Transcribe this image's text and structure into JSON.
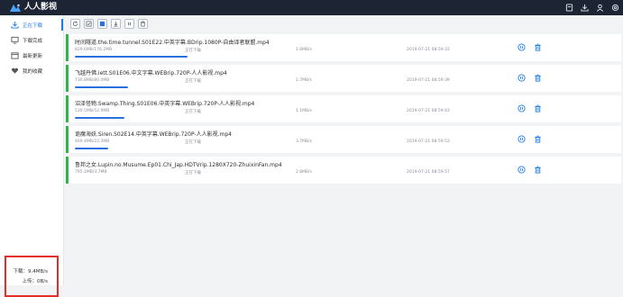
{
  "app": {
    "title": "人人影视",
    "accent": "#1e7ce8",
    "titlebar_bg": "#1d2535",
    "card_border": "#30b34a",
    "progress_color": "#2a6fe0"
  },
  "titlebar": {
    "icons": [
      {
        "name": "window-icon"
      },
      {
        "name": "download-icon"
      },
      {
        "name": "user-icon"
      },
      {
        "name": "settings-icon"
      }
    ]
  },
  "sidebar": {
    "items": [
      {
        "label": "正在下载",
        "icon": "download-icon"
      },
      {
        "label": "下载完成",
        "icon": "monitor-icon"
      },
      {
        "label": "最新更新",
        "icon": "calendar-icon"
      },
      {
        "label": "我的收藏",
        "icon": "heart-icon"
      }
    ],
    "speed": {
      "download": "下载：9.4MB/s",
      "upload": "上传：0B/s"
    }
  },
  "toolbar": {
    "buttons": [
      {
        "name": "refresh-button",
        "icon": "refresh-icon"
      },
      {
        "name": "select-all-button",
        "icon": "checkbox-icon"
      },
      {
        "name": "select-button",
        "icon": "checkbox-filled-icon"
      },
      {
        "name": "start-button",
        "icon": "arrow-down-icon"
      },
      {
        "name": "pause-button",
        "icon": "pause-icon"
      },
      {
        "name": "delete-button",
        "icon": "trash-icon"
      }
    ]
  },
  "downloads": [
    {
      "title": "时间隧道.the.time.tunnel.S01E22.中英字幕.BDrip.1080P-自由译者联盟.mp4",
      "size": "829.6MB/176.2MB",
      "status": "正在下载",
      "speed": "1.6MB/s",
      "time": "2019-07-21 08:59:33",
      "progress": 0.57
    },
    {
      "title": "飞越丹佛.iett.S01E06.中文字幕.WEBrip.720P-人人影视.mp4",
      "size": "730.8MB/80.0MB",
      "status": "正在下载",
      "speed": "2.7MB/s",
      "time": "2019-07-21 08:59:39",
      "progress": 0.27
    },
    {
      "title": "沼泽怪物.Swamp.Thing.S01E06.中英字幕.WEBrip.720P-人人影视.mp4",
      "size": "530.5MB/52.9MB",
      "status": "正在下载",
      "speed": "1.1MB/s",
      "time": "2019-07-21 08:59:43",
      "progress": 0.25
    },
    {
      "title": "诡魔海妖.Siren.S02E14.中英字幕.WEBrip.720P-人人影视.mp4",
      "size": "469.4MB/22.3MB",
      "status": "正在下载",
      "speed": "3.7MB/s",
      "time": "2019-07-21 08:59:53",
      "progress": 0.17
    },
    {
      "title": "鲁邦之女.Lupin.no.Musume.Ep01.Chi_Jap.HDTVrip.1280X720-ZhuixinFan.mp4",
      "size": "795.1MB/3.7MB",
      "status": "正在下载",
      "speed": "2.8MB/s",
      "time": "2019-07-21 08:59:57",
      "progress": 0.0
    }
  ]
}
